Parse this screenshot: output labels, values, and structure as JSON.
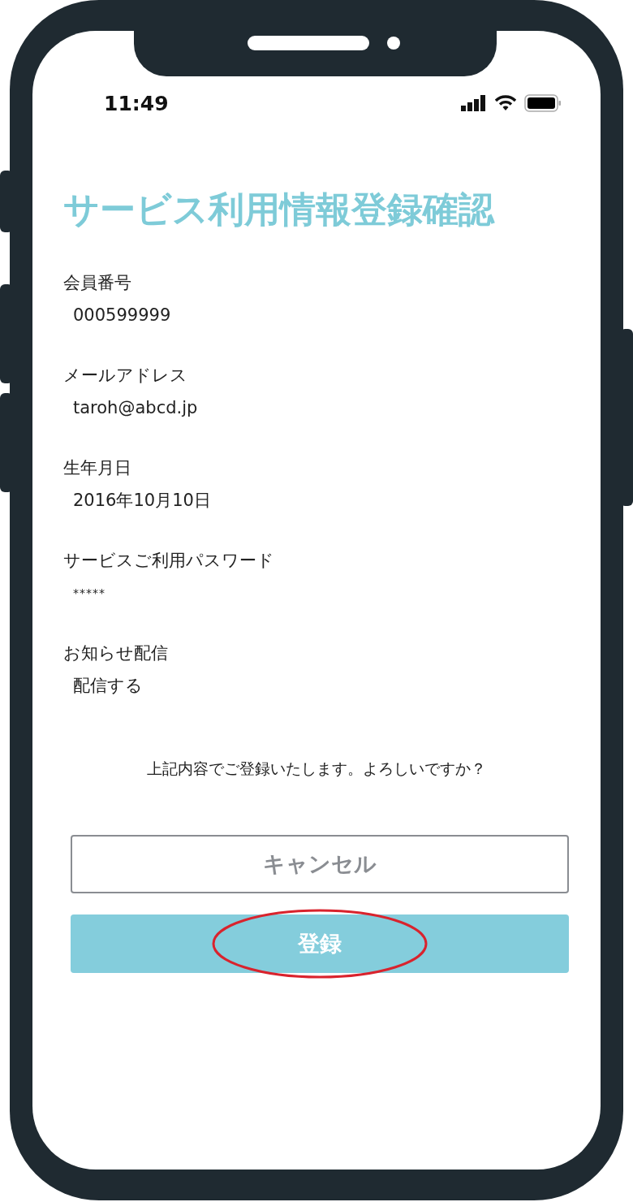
{
  "status_bar": {
    "time": "11:49"
  },
  "title": "サービス利用情報登録確認",
  "fields": [
    {
      "label": "会員番号",
      "value": "000599999"
    },
    {
      "label": "メールアドレス",
      "value": "taroh@abcd.jp"
    },
    {
      "label": "生年月日",
      "value": "2016年10月10日"
    },
    {
      "label": "サービスご利用パスワード",
      "value": "*****",
      "kind": "masked"
    },
    {
      "label": "お知らせ配信",
      "value": "配信する"
    }
  ],
  "message": "上記内容でご登録いたします。よろしいですか？",
  "buttons": [
    {
      "label": "キャンセル",
      "kind": "outline",
      "highlighted": false
    },
    {
      "label": "登録",
      "kind": "primary",
      "highlighted": true
    }
  ]
}
